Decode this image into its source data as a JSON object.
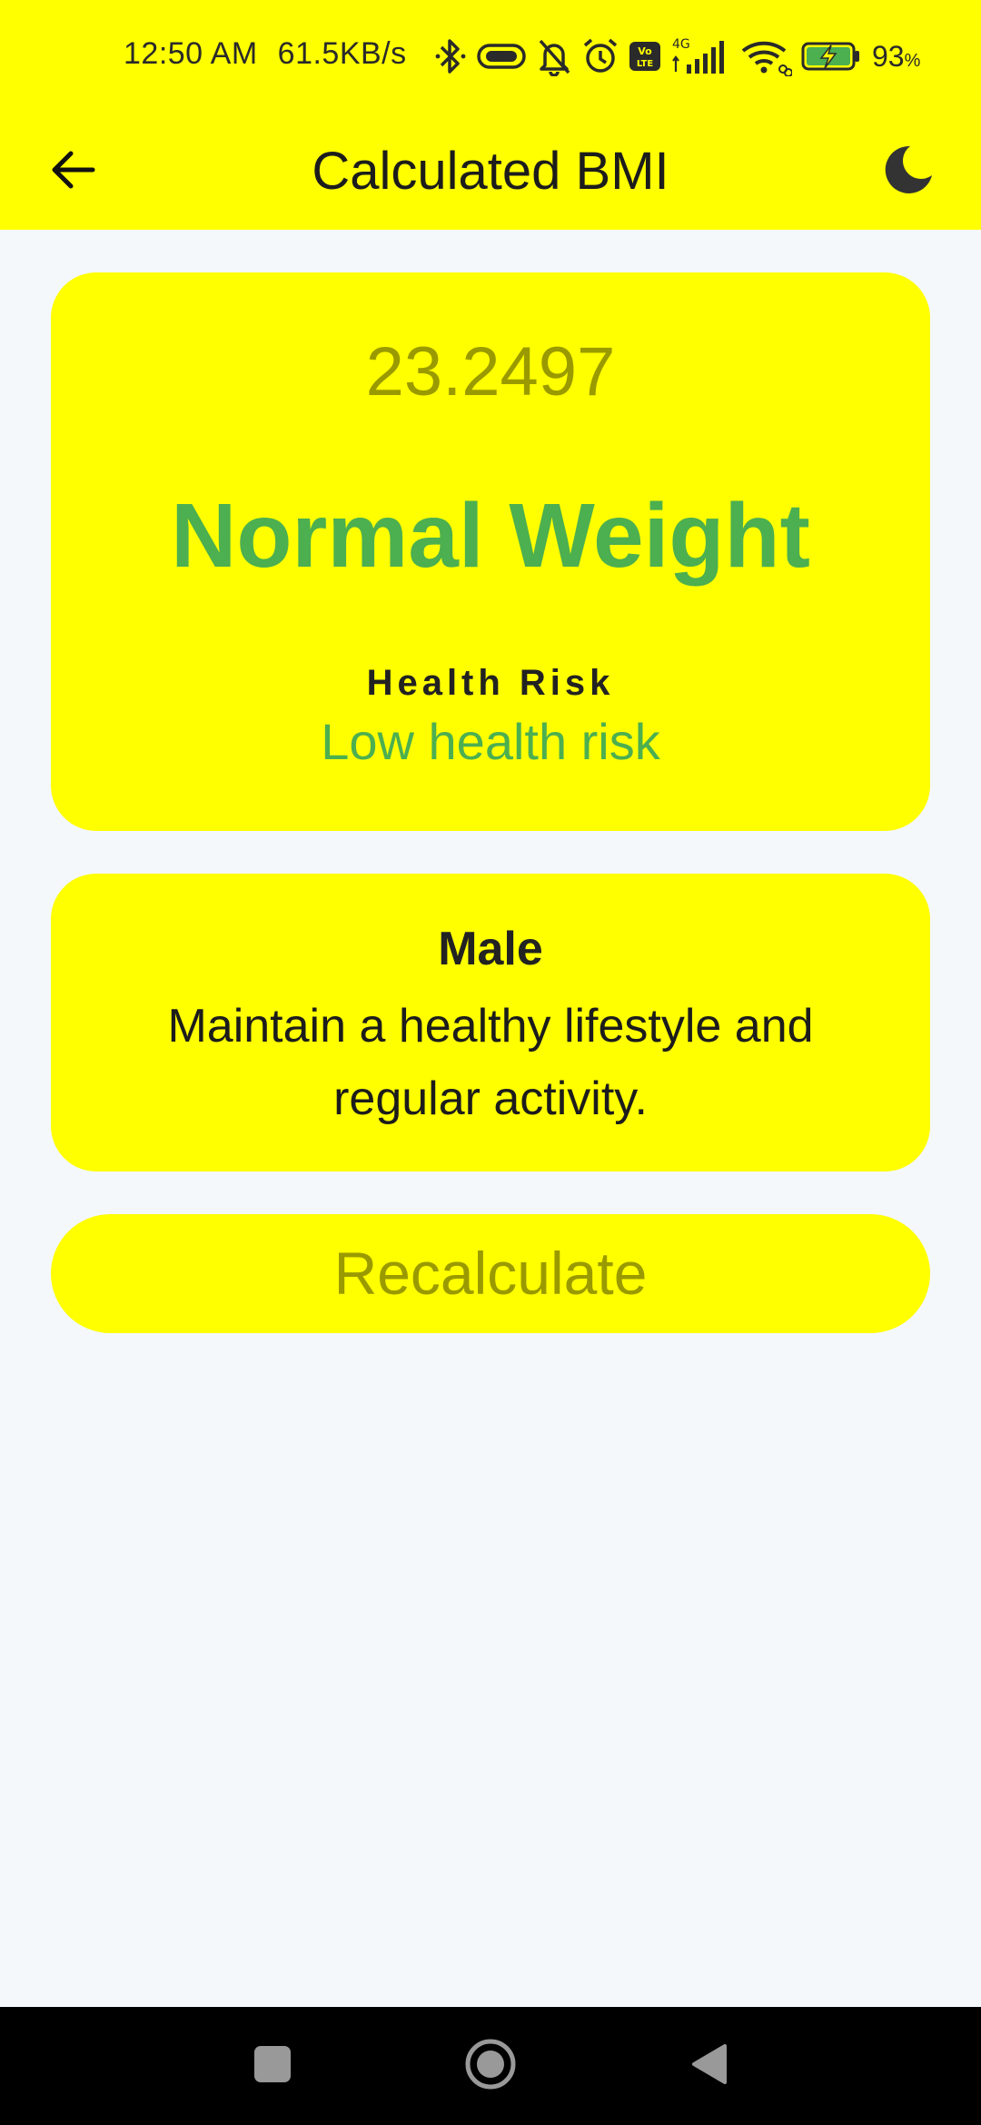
{
  "status_bar": {
    "time": "12:50 AM",
    "network_speed": "61.5KB/s",
    "network_type": "4G",
    "volte_label": "Vo LTE",
    "battery_percent": "93",
    "battery_unit": "%",
    "icons": [
      "bluetooth-icon",
      "vibrate-icon",
      "mute-icon",
      "alarm-icon",
      "volte-icon",
      "cellular-signal-icon",
      "wifi-icon",
      "battery-charging-icon"
    ]
  },
  "app_bar": {
    "title": "Calculated BMI",
    "back_icon": "arrow-left-icon",
    "theme_icon": "moon-icon"
  },
  "result": {
    "bmi_value": "23.2497",
    "category": "Normal Weight",
    "risk_heading": "Health Risk",
    "risk_value": "Low health risk"
  },
  "advice_card": {
    "gender": "Male",
    "advice": "Maintain a healthy lifestyle and regular activity."
  },
  "actions": {
    "recalculate_label": "Recalculate"
  },
  "navigation": {
    "icons": [
      "recents-icon",
      "home-icon",
      "back-triangle-icon"
    ]
  },
  "colors": {
    "accent": "#ffff00",
    "background": "#f4f8fa",
    "normal_category": "#4caf50",
    "muted_text": "#9a9a00",
    "nav_bar": "#000000"
  }
}
